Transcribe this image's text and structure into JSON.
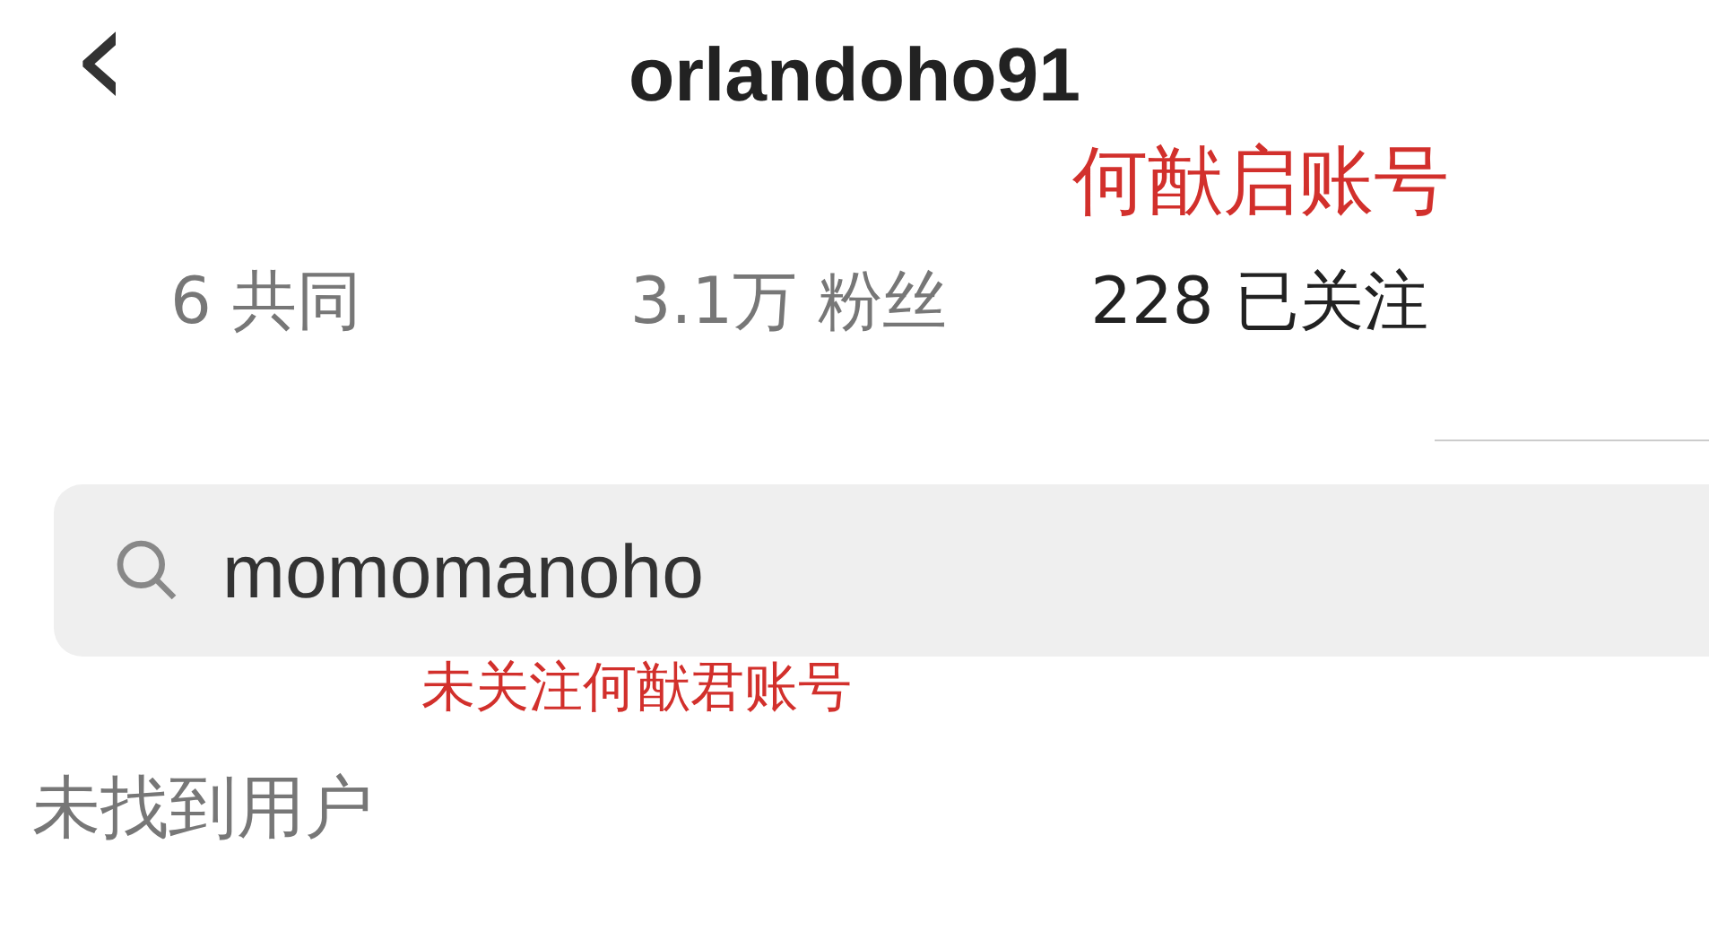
{
  "header": {
    "back": "‹",
    "title": "orlandoho91"
  },
  "annotation_top": "何猷启账号",
  "stats": [
    {
      "value": "6",
      "label": "共同",
      "emphasis": false
    },
    {
      "value": "3.1万",
      "label": "粉丝",
      "emphasis": false
    },
    {
      "value": "228",
      "label": "已关注",
      "emphasis": true
    }
  ],
  "search": {
    "value": "momomanoho"
  },
  "annotation_bottom": "未关注何猷君账号",
  "empty_message": "未找到用户"
}
